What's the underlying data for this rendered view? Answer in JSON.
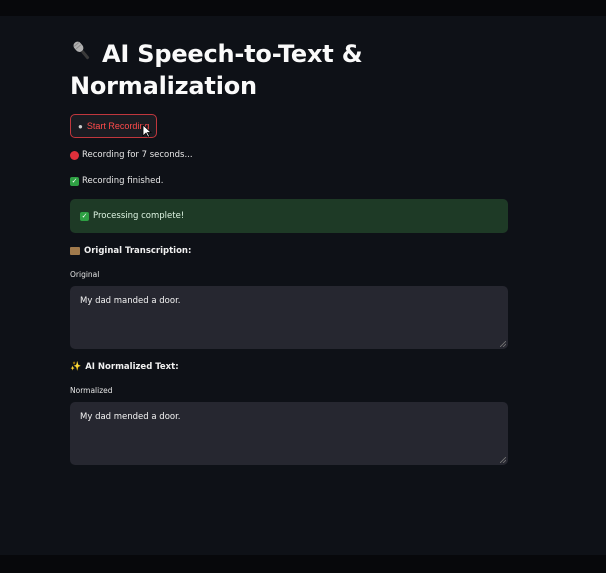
{
  "app": {
    "title": "AI Speech-to-Text & Normalization",
    "title_icon": "microphone-icon"
  },
  "controls": {
    "record_button_label": "Start Recording",
    "record_button_icon": "microphone-icon"
  },
  "status": {
    "recording_text": "Recording for 7 seconds...",
    "recording_icon": "red-circle-icon",
    "finished_text": "Recording finished.",
    "finished_icon": "check-mark-icon",
    "processing_text": "Processing complete!",
    "processing_icon": "check-mark-icon"
  },
  "original": {
    "heading": "Original Transcription:",
    "heading_icon": "film-icon",
    "field_label": "Original",
    "value": "My dad manded a door."
  },
  "normalized": {
    "heading": "AI Normalized Text:",
    "heading_icon": "sparkles-icon",
    "field_label": "Normalized",
    "value": "My dad mended a door."
  },
  "colors": {
    "background": "#0e1117",
    "accent_red": "#ff4b4b",
    "success_bg": "#1e3a26",
    "textarea_bg": "#262730"
  }
}
